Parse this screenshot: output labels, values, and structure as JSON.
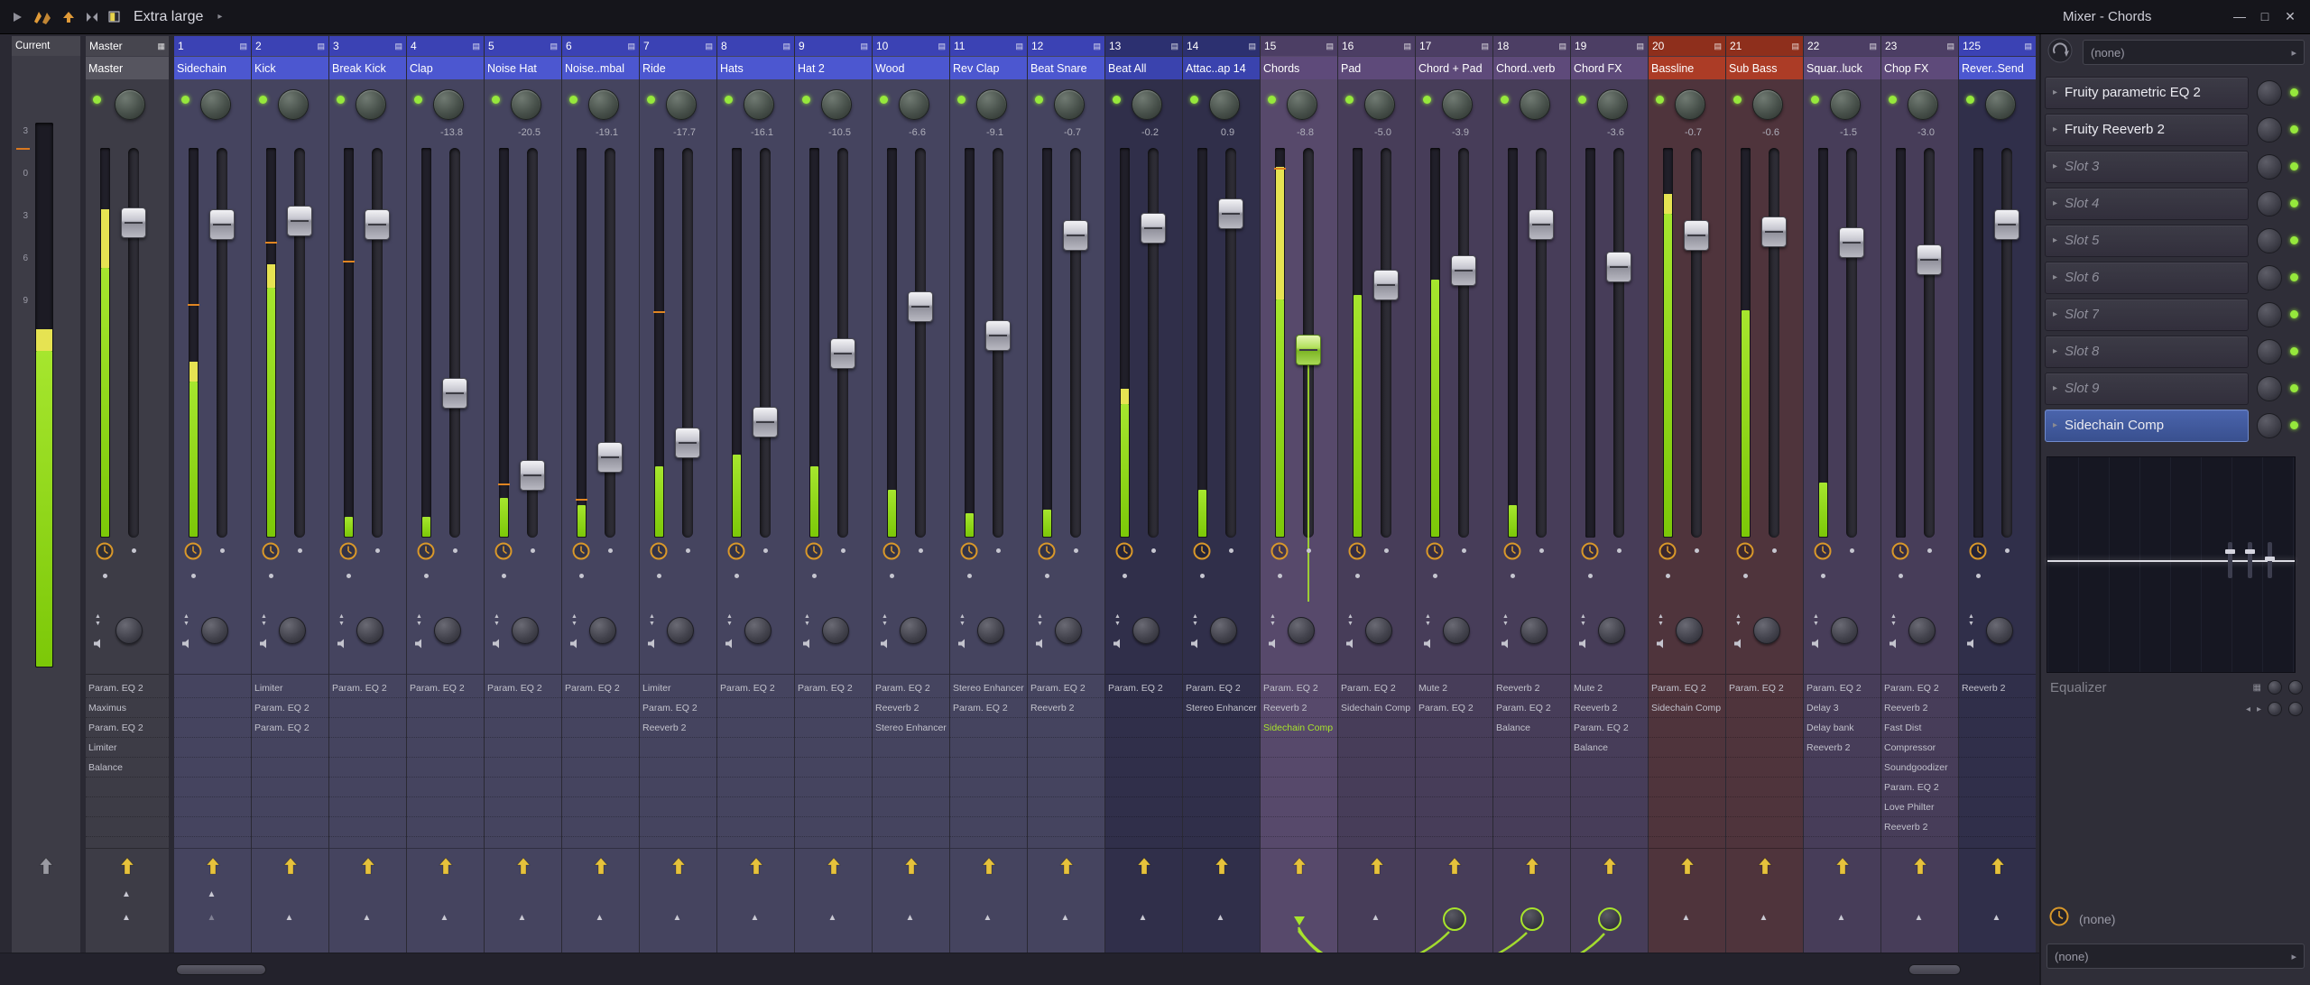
{
  "titlebar": {
    "preset": "Extra large",
    "window_title": "Mixer - Chords",
    "buttons": {
      "minimize": "—",
      "maximize": "□",
      "close": "✕"
    }
  },
  "icons": {
    "selector_arrow": "▸",
    "slot_arrow": "▸",
    "preset_arrow": "▸",
    "track_icon": "▤",
    "master_grid": "▦",
    "tri_up": "▲",
    "tri_down": "▼"
  },
  "colors": {
    "accent": "#A8E42C",
    "meter_green": "#A6E62E",
    "meter_yellow": "#E6E352",
    "led_green": "#96E83C",
    "clock_orange": "#D9982A",
    "header_blue": "#4C57D0",
    "header_purple": "#5E4A7A",
    "header_red": "#AC3C26",
    "selected_slot_blue": "#43599F"
  },
  "mixer": {
    "current": {
      "label": "Current",
      "scale": [
        "3",
        "0",
        "3",
        "6",
        "9"
      ],
      "meter": 0.62,
      "meter_yellow": 0.04
    },
    "master": {
      "label": "Master",
      "name": "Master",
      "fader": 0.165,
      "meter": 0.84,
      "meter_yellow": 0.15,
      "effects": [
        "Param. EQ 2",
        "Maximus",
        "Param. EQ 2",
        "Limiter",
        "Balance"
      ]
    },
    "channels": [
      {
        "num": "1",
        "name": "Sidechain",
        "group": "blue",
        "db": "",
        "fader": 0.17,
        "meter": 0.45,
        "meter_yellow": 0.05,
        "peak": 0.4,
        "effects": [],
        "route": "tri-dim",
        "row1": true
      },
      {
        "num": "2",
        "name": "Kick",
        "group": "blue",
        "db": "",
        "fader": 0.16,
        "meter": 0.7,
        "meter_yellow": 0.06,
        "peak": 0.24,
        "effects": [
          "Limiter",
          "Param. EQ 2",
          "Param. EQ 2"
        ]
      },
      {
        "num": "3",
        "name": "Break Kick",
        "group": "blue",
        "db": "",
        "fader": 0.17,
        "meter": 0.05,
        "peak": 0.29,
        "effects": [
          "Param. EQ 2"
        ]
      },
      {
        "num": "4",
        "name": "Clap",
        "group": "blue",
        "db": "-13.8",
        "fader": 0.64,
        "meter": 0.05,
        "effects": [
          "Param. EQ 2"
        ]
      },
      {
        "num": "5",
        "name": "Noise Hat",
        "group": "blue",
        "db": "-20.5",
        "fader": 0.87,
        "meter": 0.1,
        "peak": 0.86,
        "effects": [
          "Param. EQ 2"
        ]
      },
      {
        "num": "6",
        "name": "Noise..mbal",
        "group": "blue",
        "db": "-19.1",
        "fader": 0.82,
        "meter": 0.08,
        "peak": 0.9,
        "effects": [
          "Param. EQ 2"
        ]
      },
      {
        "num": "7",
        "name": "Ride",
        "group": "blue",
        "db": "-17.7",
        "fader": 0.78,
        "meter": 0.18,
        "peak": 0.42,
        "effects": [
          "Limiter",
          "Param. EQ 2",
          "Reeverb 2"
        ]
      },
      {
        "num": "8",
        "name": "Hats",
        "group": "blue",
        "db": "-16.1",
        "fader": 0.72,
        "meter": 0.21,
        "effects": [
          "Param. EQ 2"
        ]
      },
      {
        "num": "9",
        "name": "Hat 2",
        "group": "blue",
        "db": "-10.5",
        "fader": 0.53,
        "meter": 0.18,
        "effects": [
          "Param. EQ 2"
        ]
      },
      {
        "num": "10",
        "name": "Wood",
        "group": "blue",
        "db": "-6.6",
        "fader": 0.4,
        "meter": 0.12,
        "effects": [
          "Param. EQ 2",
          "Reeverb 2",
          "Stereo Enhancer"
        ]
      },
      {
        "num": "11",
        "name": "Rev Clap",
        "group": "blue",
        "db": "-9.1",
        "fader": 0.48,
        "meter": 0.06,
        "effects": [
          "Stereo Enhancer",
          "Param. EQ 2"
        ]
      },
      {
        "num": "12",
        "name": "Beat Snare",
        "group": "blue",
        "db": "-0.7",
        "fader": 0.2,
        "meter": 0.07,
        "effects": [
          "Param. EQ 2",
          "Reeverb 2"
        ]
      },
      {
        "num": "13",
        "name": "Beat All",
        "group": "navy",
        "db": "-0.2",
        "fader": 0.18,
        "meter": 0.38,
        "meter_yellow": 0.04,
        "effects": [
          "Param. EQ 2"
        ]
      },
      {
        "num": "14",
        "name": "Attac..ap 14",
        "group": "navy",
        "db": "0.9",
        "fader": 0.14,
        "meter": 0.12,
        "effects": [
          "Param. EQ 2",
          "Stereo Enhancer"
        ]
      },
      {
        "num": "15",
        "name": "Chords",
        "group": "purple",
        "db": "-8.8",
        "fader": 0.52,
        "meter": 0.95,
        "meter_yellow": 0.34,
        "peak": 0.05,
        "selected": true,
        "route": "down",
        "effects": [
          "Param. EQ 2",
          "Reeverb 2",
          "Sidechain Comp"
        ],
        "sel_effect": 2
      },
      {
        "num": "16",
        "name": "Pad",
        "group": "purple",
        "db": "-5.0",
        "fader": 0.34,
        "meter": 0.62,
        "effects": [
          "Param. EQ 2",
          "Sidechain Comp"
        ]
      },
      {
        "num": "17",
        "name": "Chord + Pad",
        "group": "purple",
        "db": "-3.9",
        "fader": 0.3,
        "meter": 0.66,
        "route": "knob",
        "effects": [
          "Mute 2",
          "Param. EQ 2"
        ]
      },
      {
        "num": "18",
        "name": "Chord..verb",
        "group": "purple",
        "db": "",
        "fader": 0.17,
        "meter": 0.08,
        "route": "knob",
        "effects": [
          "Reeverb 2",
          "Param. EQ 2",
          "Balance"
        ]
      },
      {
        "num": "19",
        "name": "Chord FX",
        "group": "purple",
        "db": "-3.6",
        "fader": 0.29,
        "meter": 0.0,
        "route": "knob",
        "effects": [
          "Mute 2",
          "Reeverb 2",
          "Param. EQ 2",
          "Balance"
        ]
      },
      {
        "num": "20",
        "name": "Bassline",
        "group": "red",
        "db": "-0.7",
        "fader": 0.2,
        "meter": 0.88,
        "meter_yellow": 0.05,
        "effects": [
          "Param. EQ 2",
          "Sidechain Comp"
        ]
      },
      {
        "num": "21",
        "name": "Sub Bass",
        "group": "red",
        "db": "-0.6",
        "fader": 0.19,
        "meter": 0.58,
        "effects": [
          "Param. EQ 2"
        ]
      },
      {
        "num": "22",
        "name": "Squar..luck",
        "group": "purple",
        "db": "-1.5",
        "fader": 0.22,
        "meter": 0.14,
        "effects": [
          "Param. EQ 2",
          "Delay 3",
          "Delay bank",
          "Reeverb 2"
        ]
      },
      {
        "num": "23",
        "name": "Chop FX",
        "group": "purple",
        "db": "-3.0",
        "fader": 0.27,
        "meter": 0.0,
        "effects": [
          "Param. EQ 2",
          "Reeverb 2",
          "Fast Dist",
          "Compressor",
          "Soundgoodizer",
          "Param. EQ 2",
          "Love Philter",
          "Reeverb 2"
        ]
      },
      {
        "num": "125",
        "name": "Rever..Send",
        "group": "send",
        "db": "",
        "fader": 0.17,
        "meter": 0.0,
        "effects": [
          "Reeverb 2"
        ]
      }
    ]
  },
  "rack": {
    "top_selector": "(none)",
    "slots": [
      {
        "label": "Fruity parametric EQ 2",
        "filled": true
      },
      {
        "label": "Fruity Reeverb 2",
        "filled": true
      },
      {
        "label": "Slot 3",
        "filled": false
      },
      {
        "label": "Slot 4",
        "filled": false
      },
      {
        "label": "Slot 5",
        "filled": false
      },
      {
        "label": "Slot 6",
        "filled": false
      },
      {
        "label": "Slot 7",
        "filled": false
      },
      {
        "label": "Slot 8",
        "filled": false
      },
      {
        "label": "Slot 9",
        "filled": false
      },
      {
        "label": "Sidechain Comp",
        "filled": true,
        "selected": true
      }
    ],
    "equalizer_label": "Equalizer",
    "bottom_clock_value": "(none)",
    "bottom_selector": "(none)"
  }
}
